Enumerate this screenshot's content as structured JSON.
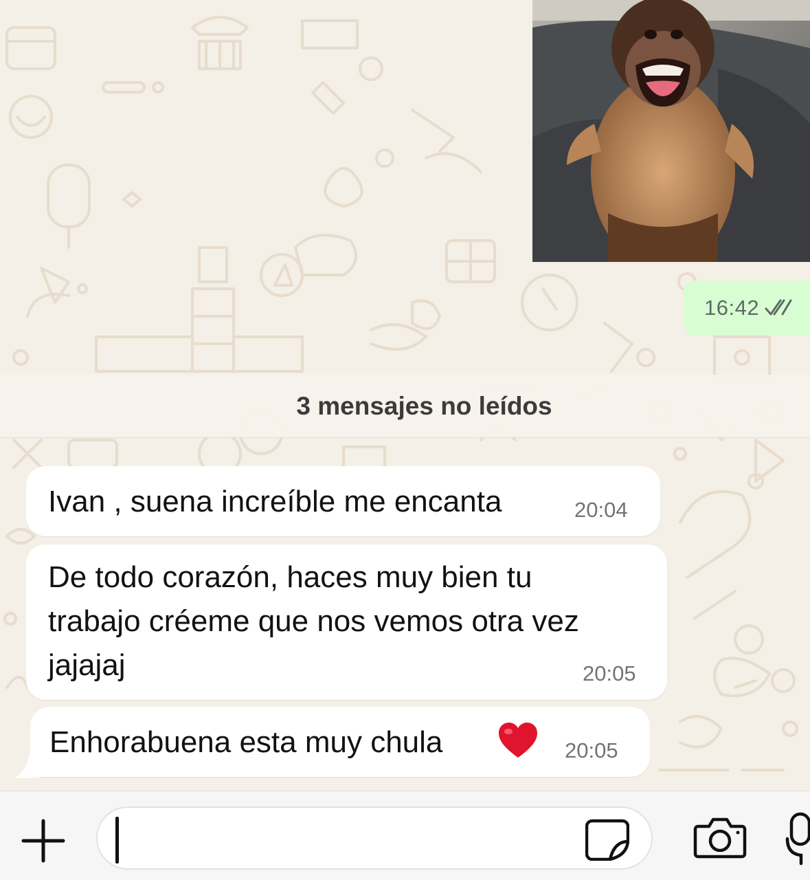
{
  "outgoing": {
    "image_alt": "capuchin-monkey-photo",
    "time": "16:42",
    "status_icon": "double-check-icon"
  },
  "unread_banner": {
    "text": "3 mensajes no leídos"
  },
  "messages": [
    {
      "text": "Ivan , suena increíble me encanta",
      "time": "20:04"
    },
    {
      "text_lines": [
        "De todo corazón, haces muy bien tu",
        "trabajo créeme que nos vemos otra vez",
        "jajajaj"
      ],
      "time": "20:05"
    },
    {
      "text": "Enhorabuena esta muy chula",
      "emoji_icon": "red-heart-icon",
      "time": "20:05"
    }
  ],
  "input_bar": {
    "placeholder": "",
    "icons": [
      "plus-icon",
      "sticker-icon",
      "camera-icon",
      "microphone-icon"
    ]
  },
  "colors": {
    "chat_background": "#f4efe7",
    "outgoing_bubble": "#d9fdd3",
    "incoming_bubble": "#ffffff",
    "tick_read": "#5f6a64",
    "heart": "#e0142d"
  }
}
